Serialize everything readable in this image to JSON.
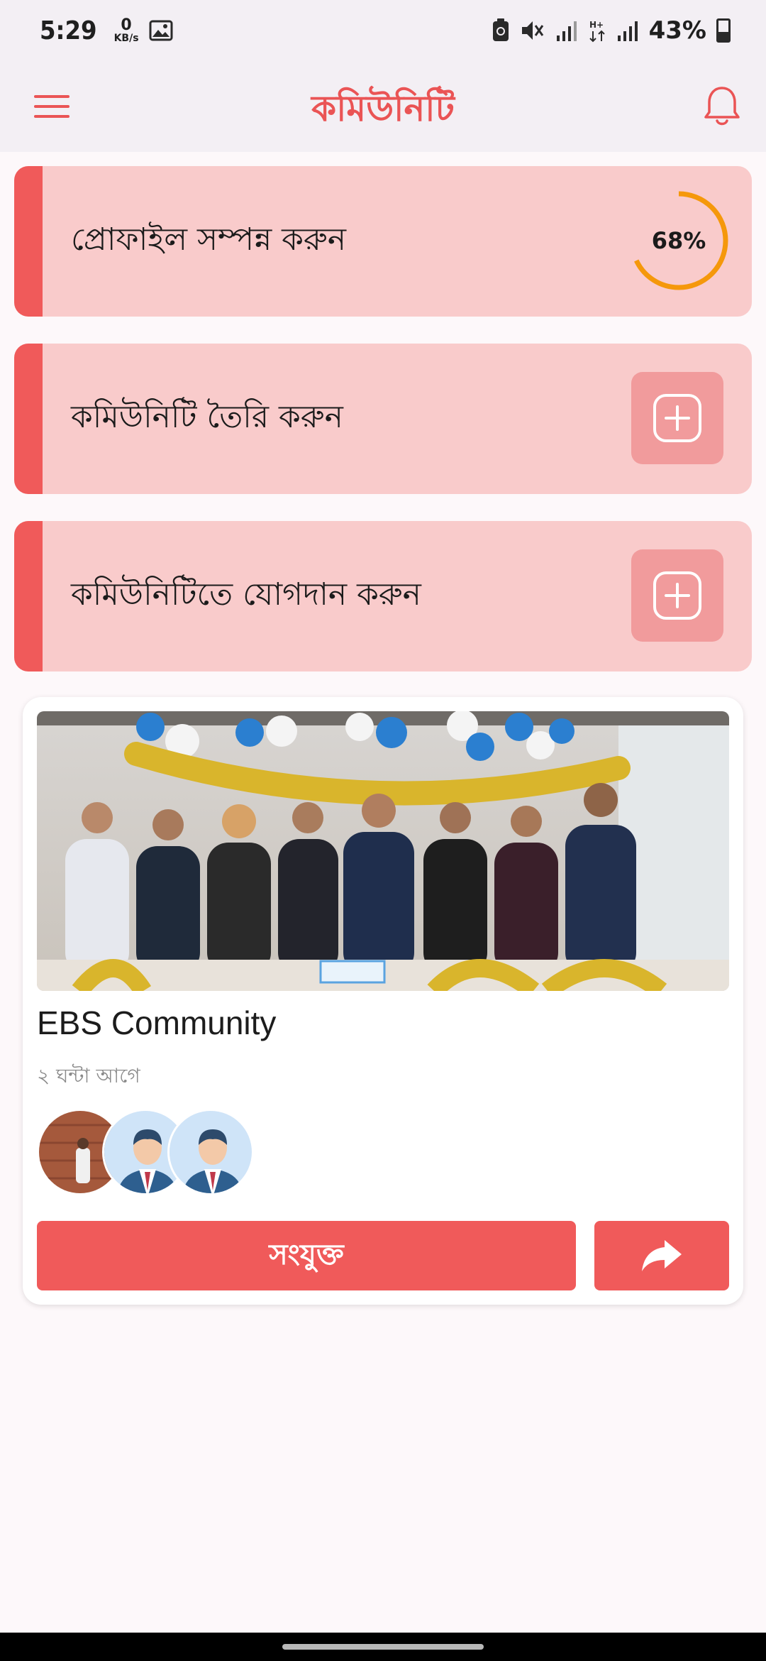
{
  "status_bar": {
    "time": "5:29",
    "net_speed_value": "0",
    "net_speed_unit": "KB/s",
    "battery_percent": "43%",
    "battery_level": 0.43
  },
  "app_bar": {
    "title": "কমিউনিটি",
    "accent_color": "#ea5455"
  },
  "actions": [
    {
      "label": "প্রোফাইল সম্পন্ন করুন",
      "progress_text": "68%",
      "progress_value": 0.68,
      "progress_color": "#f5980b"
    },
    {
      "label": "কমিউনিটি তৈরি করুন",
      "icon": "add-icon"
    },
    {
      "label": "কমিউনিটিতে যোগদান করুন",
      "icon": "add-icon"
    }
  ],
  "community": {
    "name": "EBS Community",
    "time_ago": "২ ঘন্টা আগে",
    "photo": "group-photo-image",
    "join_label": "সংযুক্ত",
    "share_icon": "share-icon",
    "members": [
      "member-photo-avatar",
      "member-default-avatar",
      "member-default-avatar"
    ]
  }
}
